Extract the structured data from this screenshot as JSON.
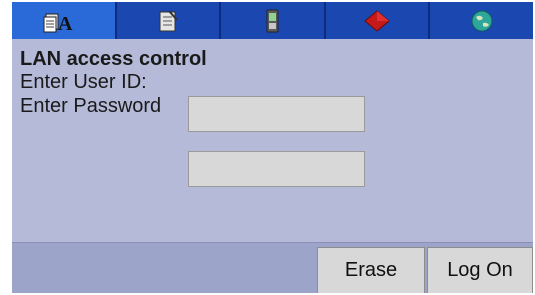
{
  "toolbar": {
    "tabs": [
      {
        "icon": "text-document-icon",
        "active": true
      },
      {
        "icon": "notepad-icon",
        "active": false
      },
      {
        "icon": "mobile-phone-icon",
        "active": false
      },
      {
        "icon": "red-book-icon",
        "active": false
      },
      {
        "icon": "globe-icon",
        "active": false
      }
    ],
    "first_tab_glyph": "A"
  },
  "main": {
    "title": "LAN access control",
    "user_id_label": "Enter User ID:",
    "password_label": "Enter Password",
    "user_id_value": "",
    "password_value": ""
  },
  "footer": {
    "erase_label": "Erase",
    "logon_label": "Log On"
  },
  "colors": {
    "toolbar": "#1a48b0",
    "toolbar_active": "#2a6ad8",
    "panel": "#b4bad8",
    "button": "#d8d8d8"
  }
}
